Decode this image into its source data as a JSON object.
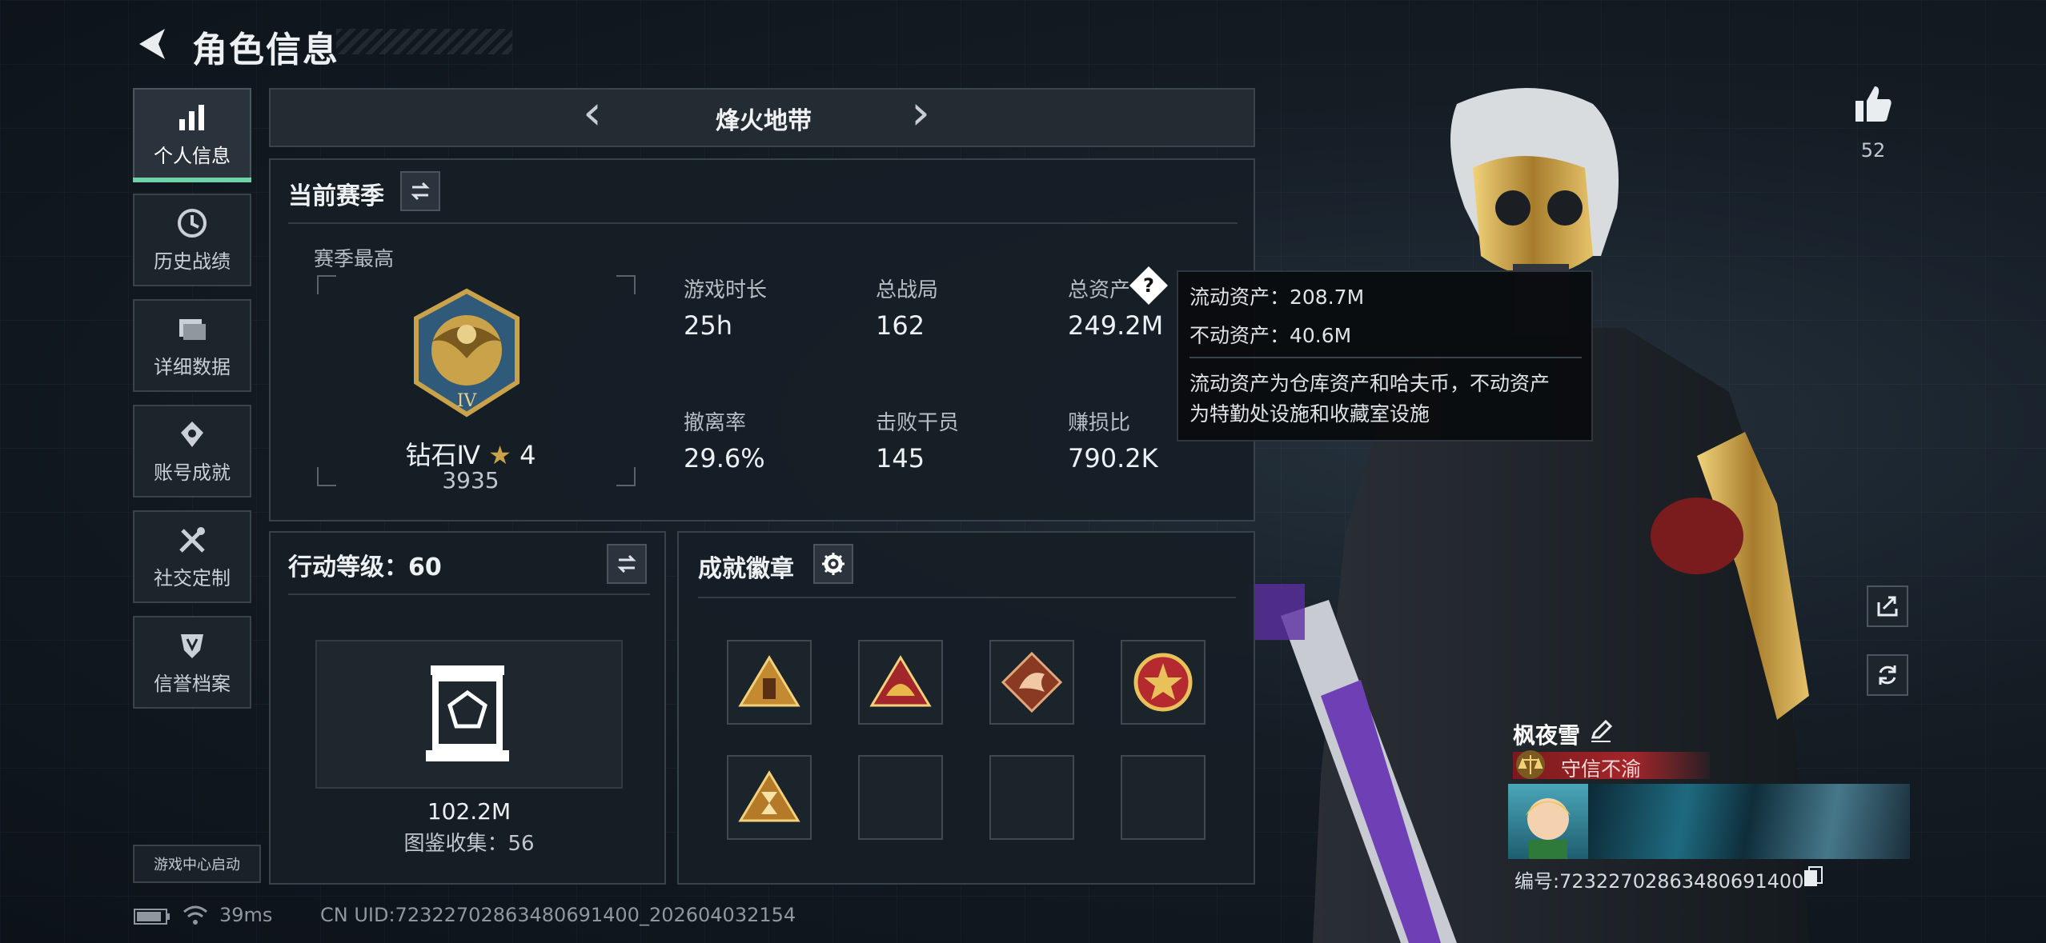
{
  "header": {
    "title": "角色信息"
  },
  "sidebar": {
    "items": [
      {
        "label": "个人信息",
        "icon": "bar-chart-icon",
        "active": true
      },
      {
        "label": "历史战绩",
        "icon": "clock-icon"
      },
      {
        "label": "详细数据",
        "icon": "folder-icon"
      },
      {
        "label": "账号成就",
        "icon": "achievement-icon"
      },
      {
        "label": "社交定制",
        "icon": "tools-icon"
      },
      {
        "label": "信誉档案",
        "icon": "shield-icon"
      }
    ],
    "launch_label": "游戏中心启动"
  },
  "mode_selector": {
    "current": "烽火地带"
  },
  "season": {
    "section_title": "当前赛季",
    "best_label": "赛季最高",
    "rank_name": "钻石Ⅳ",
    "rank_star_icon": "star-icon",
    "rank_stars": "4",
    "rank_score": "3935",
    "rank_emblem_text": "IV",
    "stats": [
      {
        "label": "游戏时长",
        "value": "25h"
      },
      {
        "label": "总战局",
        "value": "162"
      },
      {
        "label": "总资产",
        "value": "249.2M"
      },
      {
        "label": "撤离率",
        "value": "29.6%"
      },
      {
        "label": "击败干员",
        "value": "145"
      },
      {
        "label": "赚损比",
        "value": "790.2K"
      }
    ]
  },
  "tooltip": {
    "line1": "流动资产：208.7M",
    "line2": "不动资产：40.6M",
    "desc1": "流动资产为仓库资产和哈夫币，不动资产",
    "desc2": "为特勤处设施和收藏室设施"
  },
  "action_level": {
    "title": "行动等级：60",
    "collection_value": "102.2M",
    "collection_label": "图鉴收集：56"
  },
  "badges": {
    "title": "成就徽章",
    "items": [
      "badge-triangle-gold",
      "badge-triangle-helmet",
      "badge-dragon",
      "badge-star-round",
      "badge-triangle-hourglass",
      "",
      "",
      ""
    ]
  },
  "player": {
    "likes": "52",
    "name": "枫夜雪",
    "title_tag": "守信不渝",
    "id_label": "编号:7232270286348069140​0"
  },
  "status_bar": {
    "ping": "39ms",
    "uid": "CN UID:7232270286348069140​0_202604032154"
  },
  "colors": {
    "accent": "#6fd1a8",
    "tooltip_bg": "#0a0c0e",
    "title_tag": "#a3262a",
    "gold": "#c9a24a"
  }
}
